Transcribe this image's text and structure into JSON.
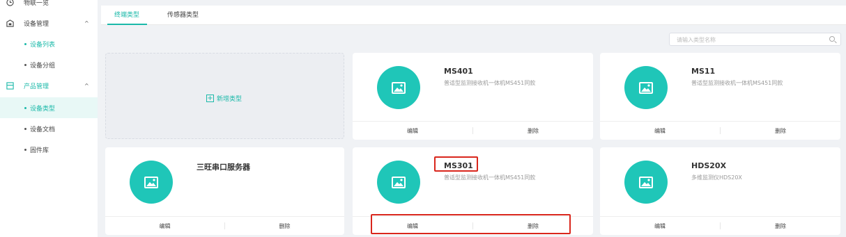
{
  "sidebar": {
    "items": [
      {
        "label": "物联一览",
        "icon": "clock-icon"
      },
      {
        "label": "设备管理",
        "icon": "device-icon"
      },
      {
        "label": "设备列表"
      },
      {
        "label": "设备分组"
      },
      {
        "label": "产品管理",
        "icon": "product-icon"
      },
      {
        "label": "设备类型"
      },
      {
        "label": "设备文档"
      },
      {
        "label": "固件库"
      }
    ],
    "arrow": "^"
  },
  "tabs": [
    "终端类型",
    "传感器类型"
  ],
  "search": {
    "placeholder": "请输入类型名称"
  },
  "add_card": {
    "plus": "+",
    "label": "新增类型"
  },
  "cards": [
    {
      "title": "MS401",
      "desc": "普适型监测接收机一体机MS451同款",
      "edit": "编辑",
      "delete": "删除"
    },
    {
      "title": "MS11",
      "desc": "普适型监测接收机一体机MS451同款",
      "edit": "编辑",
      "delete": "删除"
    },
    {
      "title": "三旺串口服务器",
      "desc": "",
      "edit": "编辑",
      "delete": "删除"
    },
    {
      "title": "MS301",
      "desc": "普适型监测接收机一体机MS451同款",
      "edit": "编辑",
      "delete": "删除"
    },
    {
      "title": "HDS20X",
      "desc": "多维监测仪HDS20X",
      "edit": "编辑",
      "delete": "删除"
    }
  ],
  "colors": {
    "accent": "#1bb9a9",
    "icon_bg": "#1fc6b8",
    "highlight": "#d9261c"
  }
}
